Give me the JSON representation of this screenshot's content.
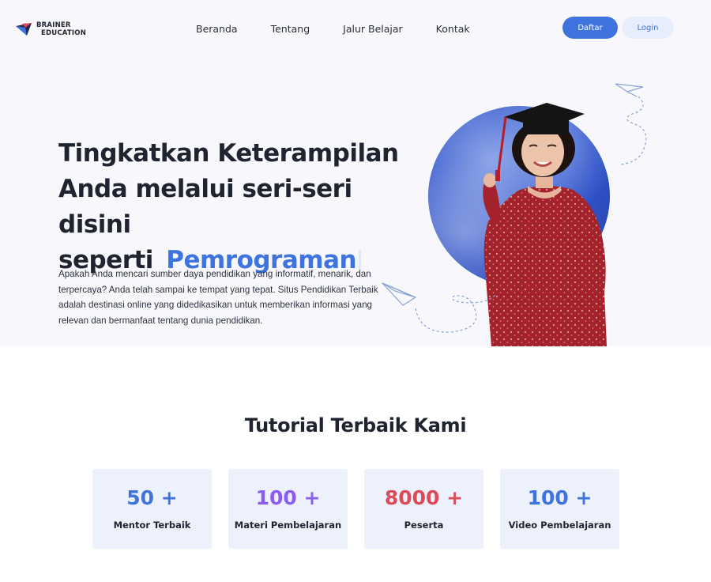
{
  "brand": {
    "line1": "BRAINER",
    "line2": "EDUCATION"
  },
  "nav": {
    "items": [
      {
        "label": "Beranda"
      },
      {
        "label": "Tentang"
      },
      {
        "label": "Jalur Belajar"
      },
      {
        "label": "Kontak"
      }
    ],
    "daftar_label": "Daftar",
    "login_label": "Login"
  },
  "hero": {
    "title_line1": "Tingkatkan Keterampilan",
    "title_line2": "Anda melalui seri-seri disini",
    "title_line3_prefix": "seperti",
    "title_line3_accent": "Pemrograman",
    "description": "Apakah Anda mencari sumber daya pendidikan yang informatif, menarik, dan terpercaya? Anda telah sampai ke tempat yang tepat. Situs Pendidikan Terbaik adalah destinasi online yang didedikasikan untuk memberikan informasi yang relevan dan bermanfaat tentang dunia pendidikan."
  },
  "tutorial": {
    "title": "Tutorial Terbaik Kami",
    "stats": [
      {
        "value": "50 +",
        "label": "Mentor Terbaik",
        "color": "#3f74de"
      },
      {
        "value": "100 +",
        "label": "Materi Pembelajaran",
        "color": "#8b5cf0"
      },
      {
        "value": "8000 +",
        "label": "Peserta",
        "color": "#dc4b5a"
      },
      {
        "value": "100 +",
        "label": "Video Pembelajaran",
        "color": "#3f74de"
      }
    ]
  },
  "colors": {
    "accent": "#3f74de",
    "hero_bg": "#f8f8fc",
    "card_bg": "#edf1fb"
  },
  "icons": {
    "logo": "brainer-logo-icon",
    "plane": "paper-plane-icon"
  }
}
